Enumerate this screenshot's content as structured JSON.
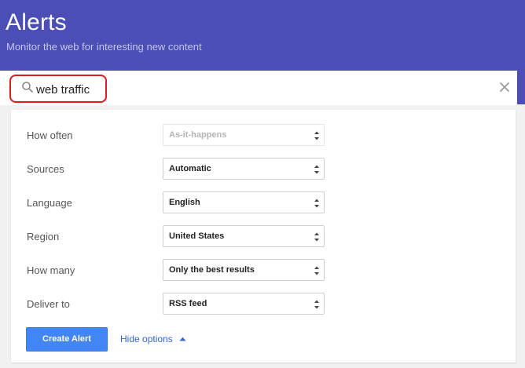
{
  "header": {
    "title": "Alerts",
    "subtitle": "Monitor the web for interesting new content",
    "background": "#4a4eb5"
  },
  "search": {
    "value": "web traffic",
    "icon": "search-icon",
    "clear_icon": "close-icon",
    "highlight_color": "#e01b1b"
  },
  "options": [
    {
      "label": "How often",
      "value": "As-it-happens",
      "disabled": true
    },
    {
      "label": "Sources",
      "value": "Automatic",
      "disabled": false
    },
    {
      "label": "Language",
      "value": "English",
      "disabled": false
    },
    {
      "label": "Region",
      "value": "United States",
      "disabled": false
    },
    {
      "label": "How many",
      "value": "Only the best results",
      "disabled": false
    },
    {
      "label": "Deliver to",
      "value": "RSS feed",
      "disabled": false
    }
  ],
  "actions": {
    "create_label": "Create Alert",
    "hide_options_label": "Hide options",
    "accent": "#4285f4"
  }
}
